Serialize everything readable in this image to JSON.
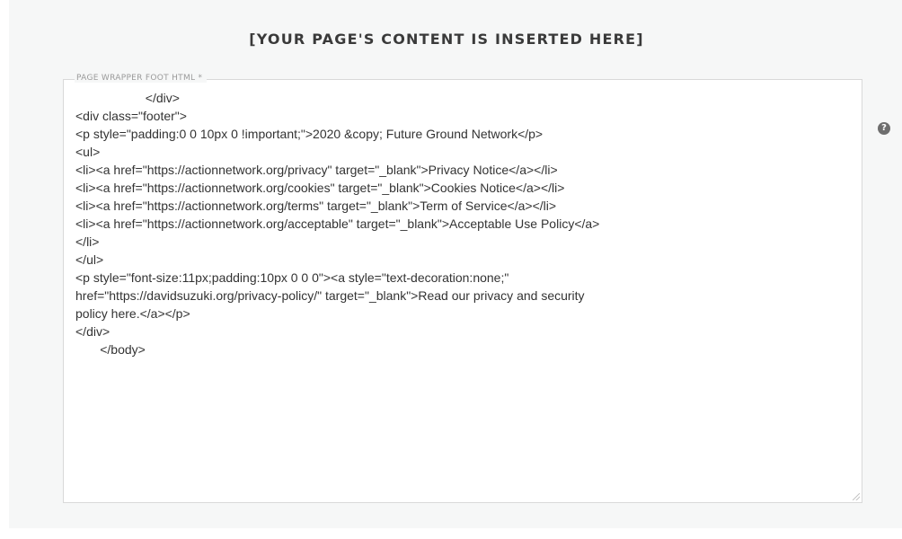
{
  "banner": {
    "text": "[YOUR PAGE'S CONTENT IS INSERTED HERE]"
  },
  "field": {
    "label": "PAGE WRAPPER FOOT HTML *",
    "value": "                    </div>\n<div class=\"footer\">\n<p style=\"padding:0 0 10px 0 !important;\">2020 &copy; Future Ground Network</p>\n<ul>\n<li><a href=\"https://actionnetwork.org/privacy\" target=\"_blank\">Privacy Notice</a></li>\n<li><a href=\"https://actionnetwork.org/cookies\" target=\"_blank\">Cookies Notice</a></li>\n<li><a href=\"https://actionnetwork.org/terms\" target=\"_blank\">Term of Service</a></li>\n<li><a href=\"https://actionnetwork.org/acceptable\" target=\"_blank\">Acceptable Use Policy</a>\n</li>\n</ul>\n<p style=\"font-size:11px;padding:10px 0 0 0\"><a style=\"text-decoration:none;\"\nhref=\"https://davidsuzuki.org/privacy-policy/\" target=\"_blank\">Read our privacy and security\npolicy here.</a></p>\n</div>\n       </body>"
  },
  "help": {
    "icon": "question-circle-icon",
    "glyph": "?"
  }
}
